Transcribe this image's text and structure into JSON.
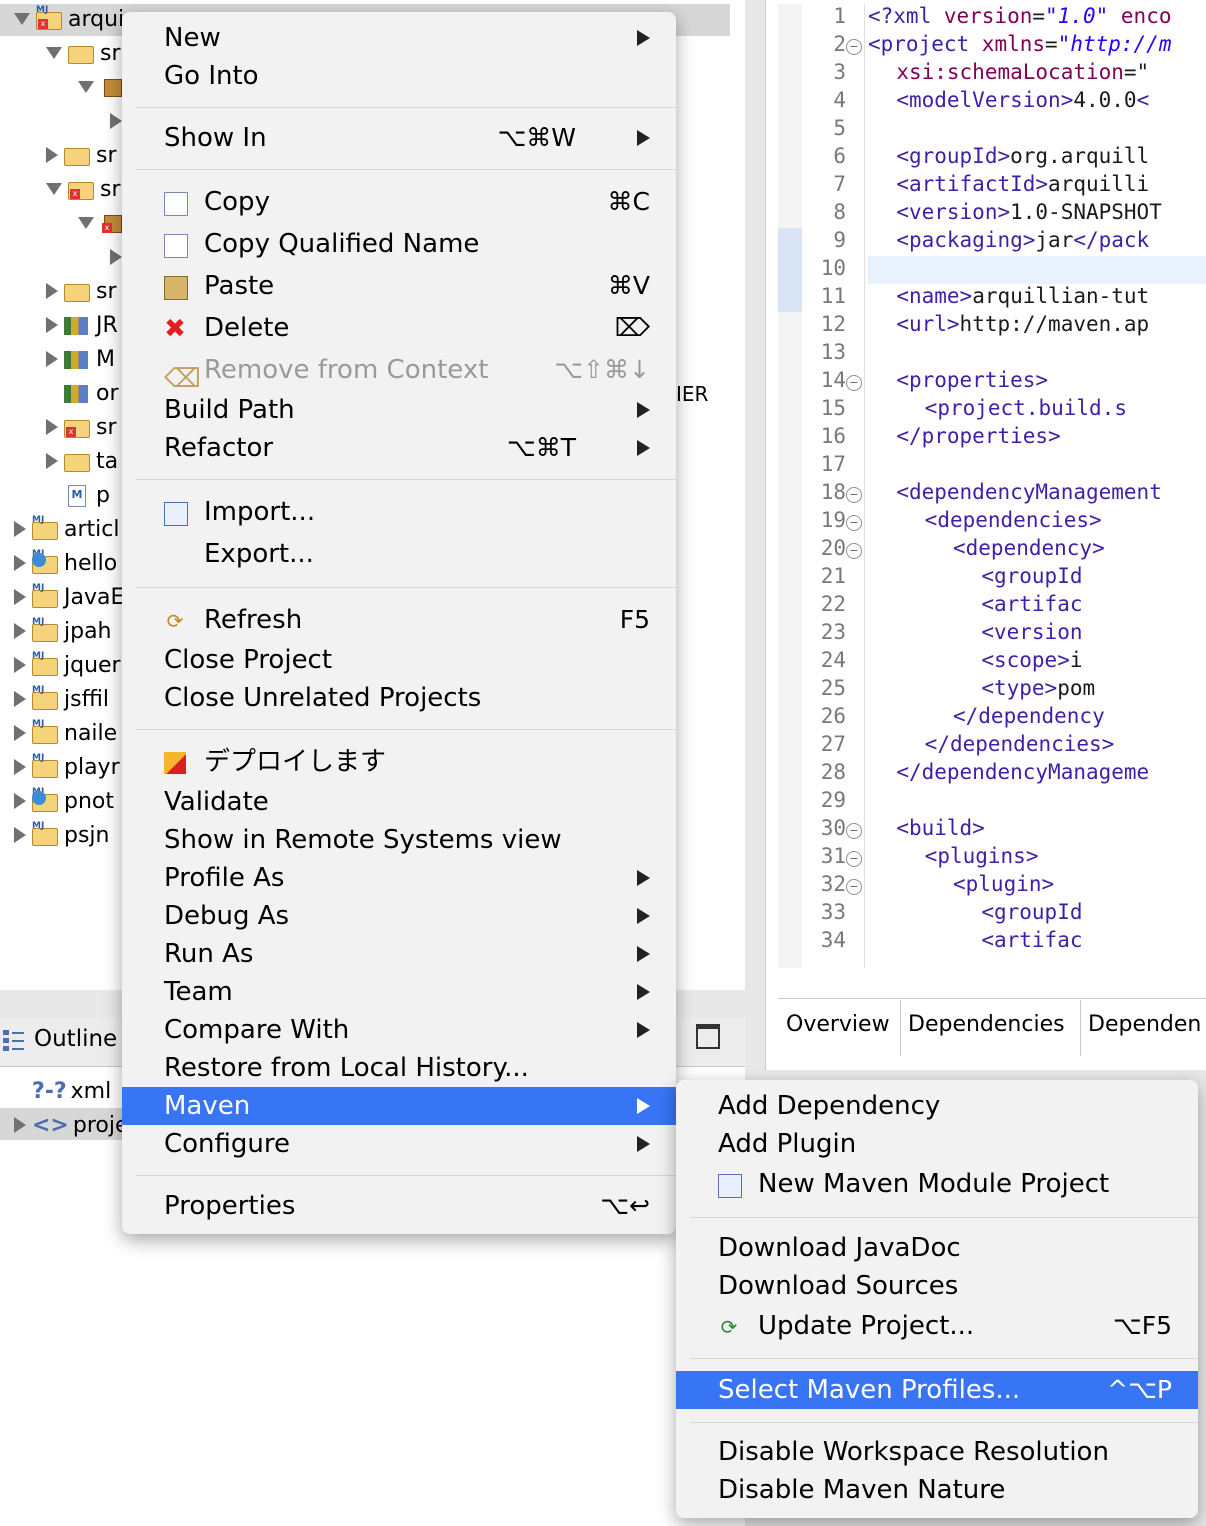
{
  "explorer": {
    "rows": [
      {
        "label": "arqui",
        "expanded": true,
        "indent": 0,
        "kind": "maven-err"
      },
      {
        "label": "sr",
        "expanded": true,
        "indent": 1,
        "kind": "src"
      },
      {
        "label": "",
        "expanded": true,
        "indent": 2,
        "kind": "pkg"
      },
      {
        "label": "",
        "expanded": false,
        "indent": 3,
        "kind": "none"
      },
      {
        "label": "sr",
        "expanded": false,
        "indent": 1,
        "kind": "src"
      },
      {
        "label": "sr",
        "expanded": true,
        "indent": 1,
        "kind": "src-err"
      },
      {
        "label": "",
        "expanded": true,
        "indent": 2,
        "kind": "pkg-err"
      },
      {
        "label": "",
        "expanded": false,
        "indent": 3,
        "kind": "none"
      },
      {
        "label": "sr",
        "expanded": false,
        "indent": 1,
        "kind": "src"
      },
      {
        "label": "JR",
        "expanded": false,
        "indent": 1,
        "kind": "lib"
      },
      {
        "label": "M",
        "expanded": false,
        "indent": 1,
        "kind": "lib"
      },
      {
        "label": "or",
        "expanded": null,
        "indent": 1,
        "kind": "lib"
      },
      {
        "label": "sr",
        "expanded": false,
        "indent": 1,
        "kind": "folder-err"
      },
      {
        "label": "ta",
        "expanded": false,
        "indent": 1,
        "kind": "folder"
      },
      {
        "label": "p",
        "expanded": null,
        "indent": 1,
        "kind": "pom"
      },
      {
        "label": "articl",
        "expanded": false,
        "indent": 0,
        "kind": "maven"
      },
      {
        "label": "hello",
        "expanded": false,
        "indent": 0,
        "kind": "maven-globe"
      },
      {
        "label": "JavaE",
        "expanded": false,
        "indent": 0,
        "kind": "maven-warn"
      },
      {
        "label": "jpah",
        "expanded": false,
        "indent": 0,
        "kind": "maven-warn"
      },
      {
        "label": "jquer",
        "expanded": false,
        "indent": 0,
        "kind": "maven"
      },
      {
        "label": "jsffil",
        "expanded": false,
        "indent": 0,
        "kind": "maven"
      },
      {
        "label": "naile",
        "expanded": false,
        "indent": 0,
        "kind": "maven"
      },
      {
        "label": "playr",
        "expanded": false,
        "indent": 0,
        "kind": "maven"
      },
      {
        "label": "pnot",
        "expanded": false,
        "indent": 0,
        "kind": "maven-globe"
      },
      {
        "label": "psjn",
        "expanded": false,
        "indent": 0,
        "kind": "maven"
      }
    ],
    "bg_text": "IER"
  },
  "outline": {
    "tab_label": "Outline",
    "rows": [
      {
        "prefix": "?-?",
        "label": "xml"
      },
      {
        "prefix": "<>",
        "label": "proje"
      }
    ]
  },
  "editor": {
    "lines": [
      {
        "n": "1",
        "fold": false,
        "indent": 0,
        "parts": [
          [
            "tag",
            "<?xml "
          ],
          [
            "attr",
            "version"
          ],
          [
            "plain",
            "="
          ],
          [
            "str",
            "\"1.0\""
          ],
          [
            "plain",
            " "
          ],
          [
            "attr",
            "enco"
          ]
        ]
      },
      {
        "n": "2",
        "fold": true,
        "indent": 0,
        "parts": [
          [
            "tag",
            "<project "
          ],
          [
            "attr",
            "xmlns"
          ],
          [
            "plain",
            "="
          ],
          [
            "str",
            "\"http://m"
          ]
        ]
      },
      {
        "n": "3",
        "fold": false,
        "indent": 2,
        "parts": [
          [
            "attr",
            "xsi:schemaLocation"
          ],
          [
            "plain",
            "=\""
          ]
        ]
      },
      {
        "n": "4",
        "fold": false,
        "indent": 2,
        "parts": [
          [
            "tag",
            "<modelVersion>"
          ],
          [
            "plain",
            "4.0.0"
          ],
          [
            "tag",
            "<"
          ]
        ]
      },
      {
        "n": "5",
        "fold": false,
        "indent": 0,
        "parts": []
      },
      {
        "n": "6",
        "fold": false,
        "indent": 2,
        "parts": [
          [
            "tag",
            "<groupId>"
          ],
          [
            "plain",
            "org.arquill"
          ]
        ]
      },
      {
        "n": "7",
        "fold": false,
        "indent": 2,
        "parts": [
          [
            "tag",
            "<artifactId>"
          ],
          [
            "plain",
            "arquilli"
          ]
        ]
      },
      {
        "n": "8",
        "fold": false,
        "indent": 2,
        "parts": [
          [
            "tag",
            "<version>"
          ],
          [
            "plain",
            "1.0-SNAPSHOT"
          ]
        ]
      },
      {
        "n": "9",
        "fold": false,
        "indent": 2,
        "parts": [
          [
            "tag",
            "<packaging>"
          ],
          [
            "plain",
            "jar"
          ],
          [
            "tag",
            "</pack"
          ]
        ]
      },
      {
        "n": "10",
        "fold": false,
        "indent": 0,
        "parts": []
      },
      {
        "n": "11",
        "fold": false,
        "indent": 2,
        "parts": [
          [
            "tag",
            "<name>"
          ],
          [
            "plain",
            "arquillian-tut"
          ]
        ]
      },
      {
        "n": "12",
        "fold": false,
        "indent": 2,
        "parts": [
          [
            "tag",
            "<url>"
          ],
          [
            "plain",
            "http://maven.ap"
          ]
        ]
      },
      {
        "n": "13",
        "fold": false,
        "indent": 0,
        "parts": []
      },
      {
        "n": "14",
        "fold": true,
        "indent": 2,
        "parts": [
          [
            "tag",
            "<properties>"
          ]
        ]
      },
      {
        "n": "15",
        "fold": false,
        "indent": 4,
        "parts": [
          [
            "tag",
            "<project.build.s"
          ]
        ]
      },
      {
        "n": "16",
        "fold": false,
        "indent": 2,
        "parts": [
          [
            "tag",
            "</properties>"
          ]
        ]
      },
      {
        "n": "17",
        "fold": false,
        "indent": 0,
        "parts": []
      },
      {
        "n": "18",
        "fold": true,
        "indent": 2,
        "parts": [
          [
            "tag",
            "<dependencyManagement"
          ]
        ]
      },
      {
        "n": "19",
        "fold": true,
        "indent": 4,
        "parts": [
          [
            "tag",
            "<dependencies>"
          ]
        ]
      },
      {
        "n": "20",
        "fold": true,
        "indent": 6,
        "parts": [
          [
            "tag",
            "<dependency>"
          ]
        ]
      },
      {
        "n": "21",
        "fold": false,
        "indent": 8,
        "parts": [
          [
            "tag",
            "<groupId"
          ]
        ]
      },
      {
        "n": "22",
        "fold": false,
        "indent": 8,
        "parts": [
          [
            "tag",
            "<artifac"
          ]
        ]
      },
      {
        "n": "23",
        "fold": false,
        "indent": 8,
        "parts": [
          [
            "tag",
            "<version"
          ]
        ]
      },
      {
        "n": "24",
        "fold": false,
        "indent": 8,
        "parts": [
          [
            "tag",
            "<scope>"
          ],
          [
            "plain",
            "i"
          ]
        ]
      },
      {
        "n": "25",
        "fold": false,
        "indent": 8,
        "parts": [
          [
            "tag",
            "<type>"
          ],
          [
            "plain",
            "pom"
          ]
        ]
      },
      {
        "n": "26",
        "fold": false,
        "indent": 6,
        "parts": [
          [
            "tag",
            "</dependency"
          ]
        ]
      },
      {
        "n": "27",
        "fold": false,
        "indent": 4,
        "parts": [
          [
            "tag",
            "</dependencies>"
          ]
        ]
      },
      {
        "n": "28",
        "fold": false,
        "indent": 2,
        "parts": [
          [
            "tag",
            "</dependencyManageme"
          ]
        ]
      },
      {
        "n": "29",
        "fold": false,
        "indent": 0,
        "parts": []
      },
      {
        "n": "30",
        "fold": true,
        "indent": 2,
        "parts": [
          [
            "tag",
            "<build>"
          ]
        ]
      },
      {
        "n": "31",
        "fold": true,
        "indent": 4,
        "parts": [
          [
            "tag",
            "<plugins>"
          ]
        ]
      },
      {
        "n": "32",
        "fold": true,
        "indent": 6,
        "parts": [
          [
            "tag",
            "<plugin>"
          ]
        ]
      },
      {
        "n": "33",
        "fold": false,
        "indent": 8,
        "parts": [
          [
            "tag",
            "<groupId"
          ]
        ]
      },
      {
        "n": "34",
        "fold": false,
        "indent": 8,
        "parts": [
          [
            "tag",
            "<artifac"
          ]
        ]
      }
    ],
    "tabs": [
      "Overview",
      "Dependencies",
      "Dependen"
    ]
  },
  "context_menu": {
    "items": [
      {
        "type": "item",
        "label": "New",
        "submenu": true
      },
      {
        "type": "item",
        "label": "Go Into"
      },
      {
        "type": "sep"
      },
      {
        "type": "item",
        "label": "Show In",
        "shortcut": "⌥⌘W",
        "submenu": true
      },
      {
        "type": "sep"
      },
      {
        "type": "item",
        "label": "Copy",
        "shortcut": "⌘C",
        "icon": "copy-icon"
      },
      {
        "type": "item",
        "label": "Copy Qualified Name",
        "icon": "copy-qualified-name-icon"
      },
      {
        "type": "item",
        "label": "Paste",
        "shortcut": "⌘V",
        "icon": "paste-icon"
      },
      {
        "type": "item",
        "label": "Delete",
        "shortcut": "⌦",
        "icon": "delete-icon"
      },
      {
        "type": "item",
        "label": "Remove from Context",
        "shortcut": "⌥⇧⌘↓",
        "icon": "remove-context-icon",
        "disabled": true
      },
      {
        "type": "item",
        "label": "Build Path",
        "submenu": true
      },
      {
        "type": "item",
        "label": "Refactor",
        "shortcut": "⌥⌘T",
        "submenu": true
      },
      {
        "type": "sep"
      },
      {
        "type": "item",
        "label": "Import...",
        "icon": "import-icon"
      },
      {
        "type": "item",
        "label": "Export...",
        "icon": "export-icon"
      },
      {
        "type": "sep"
      },
      {
        "type": "item",
        "label": "Refresh",
        "shortcut": "F5",
        "icon": "refresh-icon"
      },
      {
        "type": "item",
        "label": "Close Project"
      },
      {
        "type": "item",
        "label": "Close Unrelated Projects"
      },
      {
        "type": "sep"
      },
      {
        "type": "item",
        "label": "デプロイします",
        "icon": "deploy-icon"
      },
      {
        "type": "item",
        "label": "Validate"
      },
      {
        "type": "item",
        "label": "Show in Remote Systems view"
      },
      {
        "type": "item",
        "label": "Profile As",
        "submenu": true
      },
      {
        "type": "item",
        "label": "Debug As",
        "submenu": true
      },
      {
        "type": "item",
        "label": "Run As",
        "submenu": true
      },
      {
        "type": "item",
        "label": "Team",
        "submenu": true
      },
      {
        "type": "item",
        "label": "Compare With",
        "submenu": true
      },
      {
        "type": "item",
        "label": "Restore from Local History..."
      },
      {
        "type": "item",
        "label": "Maven",
        "submenu": true,
        "highlighted": true
      },
      {
        "type": "item",
        "label": "Configure",
        "submenu": true
      },
      {
        "type": "sep"
      },
      {
        "type": "item",
        "label": "Properties",
        "shortcut": "⌥↩"
      }
    ]
  },
  "maven_submenu": {
    "items": [
      {
        "type": "item",
        "label": "Add Dependency"
      },
      {
        "type": "item",
        "label": "Add Plugin"
      },
      {
        "type": "item",
        "label": "New Maven Module Project",
        "icon": "maven-module-icon"
      },
      {
        "type": "sep"
      },
      {
        "type": "item",
        "label": "Download JavaDoc"
      },
      {
        "type": "item",
        "label": "Download Sources"
      },
      {
        "type": "item",
        "label": "Update Project...",
        "shortcut": "⌥F5",
        "icon": "update-project-icon"
      },
      {
        "type": "sep"
      },
      {
        "type": "item",
        "label": "Select Maven Profiles...",
        "shortcut": "^⌥P",
        "highlighted": true
      },
      {
        "type": "sep"
      },
      {
        "type": "item",
        "label": "Disable Workspace Resolution"
      },
      {
        "type": "item",
        "label": "Disable Maven Nature"
      }
    ]
  }
}
